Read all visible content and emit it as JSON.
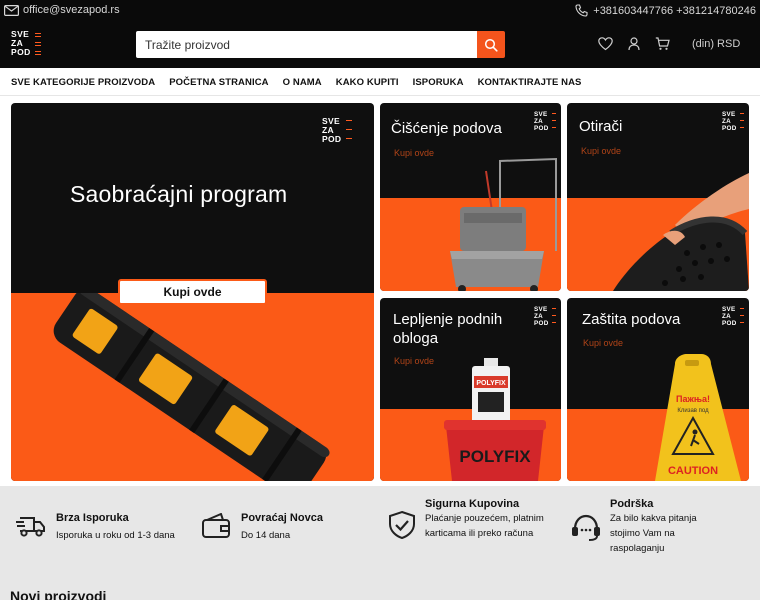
{
  "topbar": {
    "email": "office@svezapod.rs",
    "phones": "+381603447766 +381214780246"
  },
  "brand": {
    "logo_lines": [
      "SVE",
      "ZA",
      "POD"
    ]
  },
  "header": {
    "search_placeholder": "Tražite proizvod",
    "currency": "(din) RSD"
  },
  "nav": {
    "items": [
      "SVE KATEGORIJE PROIZVODA",
      "POČETNA STRANICA",
      "O NAMA",
      "KAKO KUPITI",
      "ISPORUKA",
      "KONTAKTIRAJTE NAS"
    ]
  },
  "hero": {
    "title": "Saobraćajni program",
    "button": "Kupi ovde"
  },
  "tiles": [
    {
      "title": "Čišćenje podova",
      "link": "Kupi ovde"
    },
    {
      "title": "Otirači",
      "link": "Kupi ovde"
    },
    {
      "title": "Lepljenje podnih obloga",
      "link": "Kupi ovde"
    },
    {
      "title": "Zaštita podova",
      "link": "Kupi ovde"
    }
  ],
  "product_labels": {
    "polyfix_bottle": "POLYFIX",
    "polyfix_bucket": "POLYFIX",
    "sign_top": "Пажња!",
    "sign_sub": "Клизав под",
    "sign_caution": "CAUTION"
  },
  "features": [
    {
      "icon": "truck-icon",
      "title": "Brza Isporuka",
      "desc": "Isporuka u roku od 1-3 dana"
    },
    {
      "icon": "wallet-icon",
      "title": "Povraćaj Novca",
      "desc": "Do 14 dana"
    },
    {
      "icon": "shield-check-icon",
      "title": "Sigurna Kupovina",
      "desc": "Plaćanje pouzećem, platnim karticama ili preko računa"
    },
    {
      "icon": "headset-icon",
      "title": "Podrška",
      "desc": "Za bilo kakva pitanja stojimo Vam na raspolaganju"
    }
  ],
  "sections": {
    "new_products": "Novi proizvodi"
  },
  "colors": {
    "accent": "#fb5a17",
    "dark": "#0a0a0a"
  }
}
